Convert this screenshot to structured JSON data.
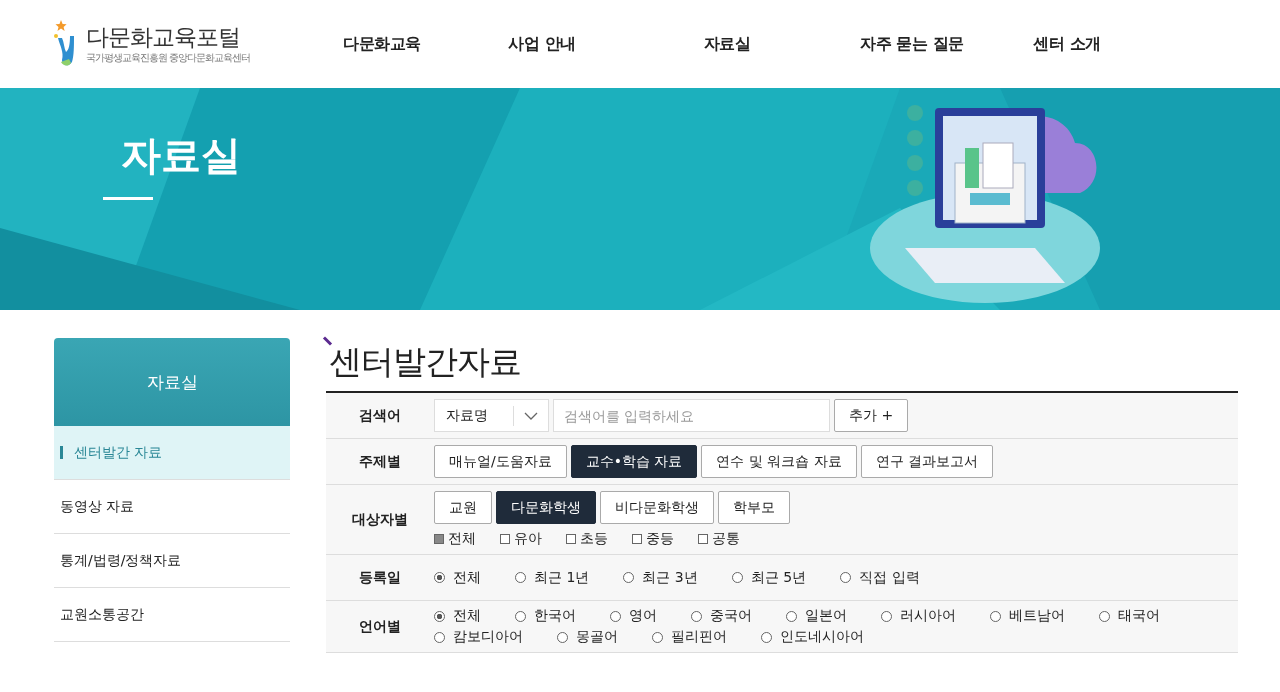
{
  "logo": {
    "title": "다문화교육포털",
    "subtitle": "국가평생교육진흥원 중앙다문화교육센터"
  },
  "nav": [
    {
      "label": "다문화교육"
    },
    {
      "label": "사업 안내"
    },
    {
      "label": "자료실"
    },
    {
      "label": "자주 묻는 질문"
    },
    {
      "label": "센터 소개"
    }
  ],
  "banner": {
    "title": "자료실"
  },
  "sidebar": {
    "title": "자료실",
    "items": [
      {
        "label": "센터발간 자료",
        "selected": true
      },
      {
        "label": "동영상 자료",
        "selected": false
      },
      {
        "label": "통계/법령/정책자료",
        "selected": false
      },
      {
        "label": "교원소통공간",
        "selected": false
      }
    ]
  },
  "page_title": "센터발간자료",
  "filters": [
    {
      "kind": "search",
      "label": "검색어",
      "select": "자료명",
      "placeholder": "검색어를 입력하세요",
      "button": "추가 +"
    },
    {
      "kind": "buttons",
      "label": "주제별",
      "options": [
        {
          "label": "매뉴얼/도움자료",
          "selected": false
        },
        {
          "label": "교수•학습 자료",
          "selected": true
        },
        {
          "label": "연수 및 워크숍 자료",
          "selected": false
        },
        {
          "label": "연구 결과보고서",
          "selected": false
        }
      ]
    },
    {
      "kind": "buttons",
      "label": "대상자별",
      "options": [
        {
          "label": "교원",
          "selected": false
        },
        {
          "label": "다문화학생",
          "selected": true
        },
        {
          "label": "비다문화학생",
          "selected": false
        },
        {
          "label": "학부모",
          "selected": false
        }
      ],
      "checks": [
        {
          "label": "전체",
          "checked": true
        },
        {
          "label": "유아",
          "checked": false
        },
        {
          "label": "초등",
          "checked": false
        },
        {
          "label": "중등",
          "checked": false
        },
        {
          "label": "공통",
          "checked": false
        }
      ]
    },
    {
      "kind": "radios",
      "label": "등록일",
      "options": [
        {
          "label": "전체",
          "selected": true
        },
        {
          "label": "최근 1년",
          "selected": false
        },
        {
          "label": "최근 3년",
          "selected": false
        },
        {
          "label": "최근 5년",
          "selected": false
        },
        {
          "label": "직접 입력",
          "selected": false
        }
      ]
    },
    {
      "kind": "radios",
      "label": "언어별",
      "options": [
        {
          "label": "전체",
          "selected": true
        },
        {
          "label": "한국어",
          "selected": false
        },
        {
          "label": "영어",
          "selected": false
        },
        {
          "label": "중국어",
          "selected": false
        },
        {
          "label": "일본어",
          "selected": false
        },
        {
          "label": "러시아어",
          "selected": false
        },
        {
          "label": "베트남어",
          "selected": false
        },
        {
          "label": "태국어",
          "selected": false
        },
        {
          "label": "캄보디아어",
          "selected": false
        },
        {
          "label": "몽골어",
          "selected": false
        },
        {
          "label": "필리핀어",
          "selected": false
        },
        {
          "label": "인도네시아어",
          "selected": false
        }
      ]
    }
  ]
}
